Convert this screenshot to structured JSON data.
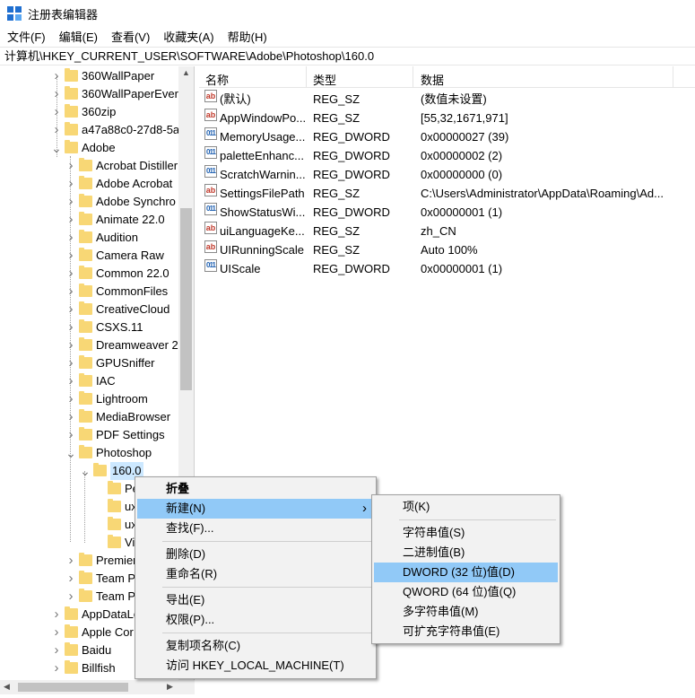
{
  "window": {
    "title": "注册表编辑器"
  },
  "menubar": [
    "文件(F)",
    "编辑(E)",
    "查看(V)",
    "收藏夹(A)",
    "帮助(H)"
  ],
  "address": "计算机\\HKEY_CURRENT_USER\\SOFTWARE\\Adobe\\Photoshop\\160.0",
  "tree": [
    {
      "label": "360WallPaper",
      "level": 0,
      "expand": "collapsed"
    },
    {
      "label": "360WallPaperEver",
      "level": 0,
      "expand": "collapsed"
    },
    {
      "label": "360zip",
      "level": 0,
      "expand": "collapsed"
    },
    {
      "label": "a47a88c0-27d8-5a",
      "level": 0,
      "expand": "collapsed"
    },
    {
      "label": "Adobe",
      "level": 0,
      "expand": "expanded"
    },
    {
      "label": "Acrobat Distiller",
      "level": 1,
      "expand": "collapsed"
    },
    {
      "label": "Adobe Acrobat",
      "level": 1,
      "expand": "collapsed"
    },
    {
      "label": "Adobe Synchro",
      "level": 1,
      "expand": "collapsed"
    },
    {
      "label": "Animate 22.0",
      "level": 1,
      "expand": "collapsed"
    },
    {
      "label": "Audition",
      "level": 1,
      "expand": "collapsed"
    },
    {
      "label": "Camera Raw",
      "level": 1,
      "expand": "collapsed"
    },
    {
      "label": "Common 22.0",
      "level": 1,
      "expand": "collapsed"
    },
    {
      "label": "CommonFiles",
      "level": 1,
      "expand": "collapsed"
    },
    {
      "label": "CreativeCloud",
      "level": 1,
      "expand": "collapsed"
    },
    {
      "label": "CSXS.11",
      "level": 1,
      "expand": "collapsed"
    },
    {
      "label": "Dreamweaver 2",
      "level": 1,
      "expand": "collapsed"
    },
    {
      "label": "GPUSniffer",
      "level": 1,
      "expand": "collapsed"
    },
    {
      "label": "IAC",
      "level": 1,
      "expand": "collapsed"
    },
    {
      "label": "Lightroom",
      "level": 1,
      "expand": "collapsed"
    },
    {
      "label": "MediaBrowser",
      "level": 1,
      "expand": "collapsed"
    },
    {
      "label": "PDF Settings",
      "level": 1,
      "expand": "collapsed"
    },
    {
      "label": "Photoshop",
      "level": 1,
      "expand": "expanded"
    },
    {
      "label": "160.0",
      "level": 2,
      "expand": "expanded",
      "selected": true
    },
    {
      "label": "Pe",
      "level": 3,
      "expand": "none"
    },
    {
      "label": "ux",
      "level": 3,
      "expand": "none"
    },
    {
      "label": "ux",
      "level": 3,
      "expand": "none"
    },
    {
      "label": "Vi",
      "level": 3,
      "expand": "none"
    },
    {
      "label": "Premier",
      "level": 1,
      "expand": "collapsed"
    },
    {
      "label": "Team P",
      "level": 1,
      "expand": "collapsed"
    },
    {
      "label": "Team P",
      "level": 1,
      "expand": "collapsed"
    },
    {
      "label": "AppDataLo",
      "level": 0,
      "expand": "collapsed"
    },
    {
      "label": "Apple Cor",
      "level": 0,
      "expand": "collapsed"
    },
    {
      "label": "Baidu",
      "level": 0,
      "expand": "collapsed"
    },
    {
      "label": "Billfish",
      "level": 0,
      "expand": "collapsed"
    }
  ],
  "list": {
    "columns": [
      "名称",
      "类型",
      "数据"
    ],
    "rows": [
      {
        "name": "(默认)",
        "type": "REG_SZ",
        "data": "(数值未设置)",
        "icon": "string-value-icon"
      },
      {
        "name": "AppWindowPo...",
        "type": "REG_SZ",
        "data": "[55,32,1671,971]",
        "icon": "string-value-icon"
      },
      {
        "name": "MemoryUsage...",
        "type": "REG_DWORD",
        "data": "0x00000027 (39)",
        "icon": "binary-value-icon"
      },
      {
        "name": "paletteEnhanc...",
        "type": "REG_DWORD",
        "data": "0x00000002 (2)",
        "icon": "binary-value-icon"
      },
      {
        "name": "ScratchWarnin...",
        "type": "REG_DWORD",
        "data": "0x00000000 (0)",
        "icon": "binary-value-icon"
      },
      {
        "name": "SettingsFilePath",
        "type": "REG_SZ",
        "data": "C:\\Users\\Administrator\\AppData\\Roaming\\Ad...",
        "icon": "string-value-icon"
      },
      {
        "name": "ShowStatusWi...",
        "type": "REG_DWORD",
        "data": "0x00000001 (1)",
        "icon": "binary-value-icon"
      },
      {
        "name": "uiLanguageKe...",
        "type": "REG_SZ",
        "data": "zh_CN",
        "icon": "string-value-icon"
      },
      {
        "name": "UIRunningScale",
        "type": "REG_SZ",
        "data": "Auto 100%",
        "icon": "string-value-icon"
      },
      {
        "name": "UIScale",
        "type": "REG_DWORD",
        "data": "0x00000001 (1)",
        "icon": "binary-value-icon"
      }
    ]
  },
  "context_menu": {
    "items": [
      {
        "label": "折叠",
        "bold": true
      },
      {
        "label": "新建(N)",
        "highlight": true,
        "submenu": true
      },
      {
        "label": "查找(F)..."
      },
      {
        "sep": true
      },
      {
        "label": "删除(D)"
      },
      {
        "label": "重命名(R)"
      },
      {
        "sep": true
      },
      {
        "label": "导出(E)"
      },
      {
        "label": "权限(P)..."
      },
      {
        "sep": true
      },
      {
        "label": "复制项名称(C)"
      },
      {
        "label": "访问 HKEY_LOCAL_MACHINE(T)"
      }
    ]
  },
  "submenu": {
    "items": [
      {
        "label": "项(K)"
      },
      {
        "sep": true
      },
      {
        "label": "字符串值(S)"
      },
      {
        "label": "二进制值(B)"
      },
      {
        "label": "DWORD (32 位)值(D)",
        "highlight": true
      },
      {
        "label": "QWORD (64 位)值(Q)"
      },
      {
        "label": "多字符串值(M)"
      },
      {
        "label": "可扩充字符串值(E)"
      }
    ]
  },
  "colors": {
    "highlight": "#91c9f7",
    "selection": "#cce8ff",
    "folder": "#f8d775"
  }
}
